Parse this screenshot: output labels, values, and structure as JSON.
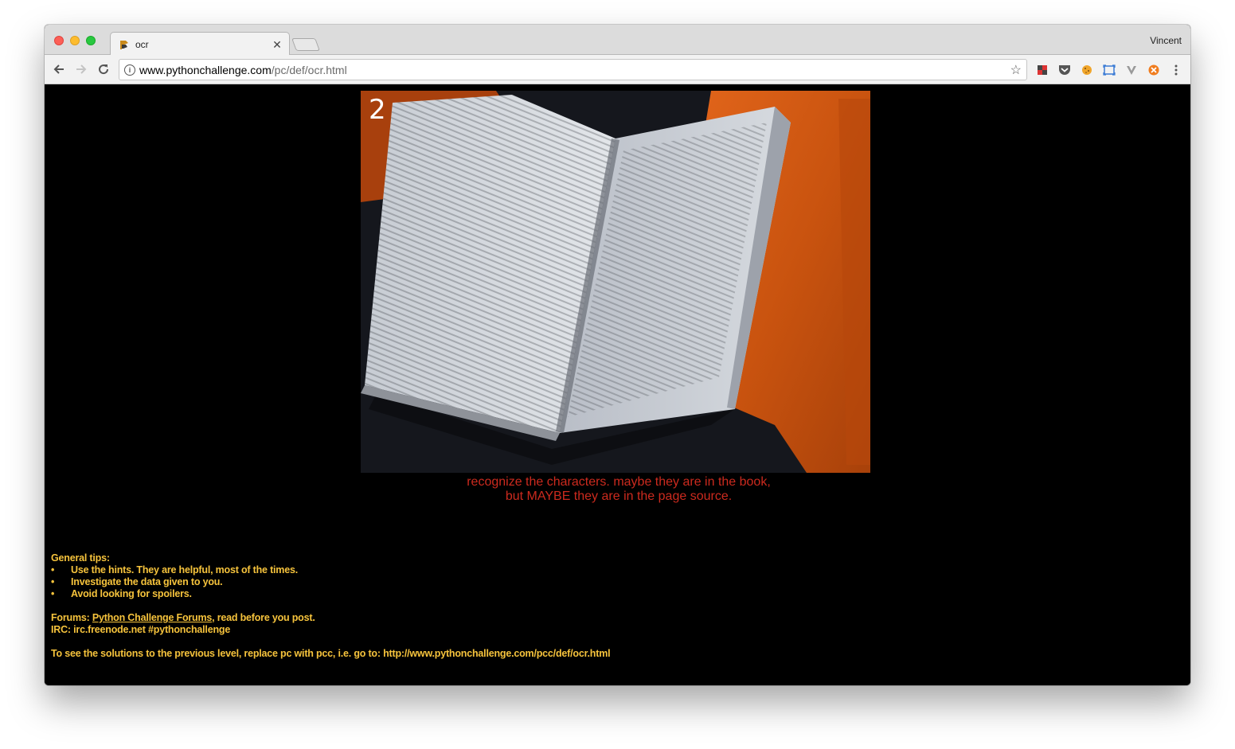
{
  "browser": {
    "tab_title": "ocr",
    "profile_name": "Vincent",
    "url_host": "www.pythonchallenge.com",
    "url_path": "/pc/def/ocr.html",
    "icons": [
      "back-icon",
      "forward-icon",
      "reload-icon",
      "info-icon",
      "star-icon",
      "menu-icon"
    ]
  },
  "page": {
    "level_number": "2",
    "riddle_line1": "recognize the characters. maybe they are in the book,",
    "riddle_line2": "but MAYBE they are in the page source.",
    "tips_heading": "General tips:",
    "tips": [
      "Use the hints. They are helpful, most of the times.",
      "Investigate the data given to you.",
      "Avoid looking for spoilers."
    ],
    "forums_prefix": "Forums: ",
    "forums_link": "Python Challenge Forums",
    "forums_suffix": ", read before you post.",
    "irc": "IRC: irc.freenode.net #pythonchallenge",
    "solutions": "To see the solutions to the previous level, replace pc with pcc, i.e. go to: http://www.pythonchallenge.com/pcc/def/ocr.html"
  },
  "colors": {
    "riddle": "#cc2a1e",
    "tips": "#f6c33c",
    "page_bg": "#000000"
  }
}
